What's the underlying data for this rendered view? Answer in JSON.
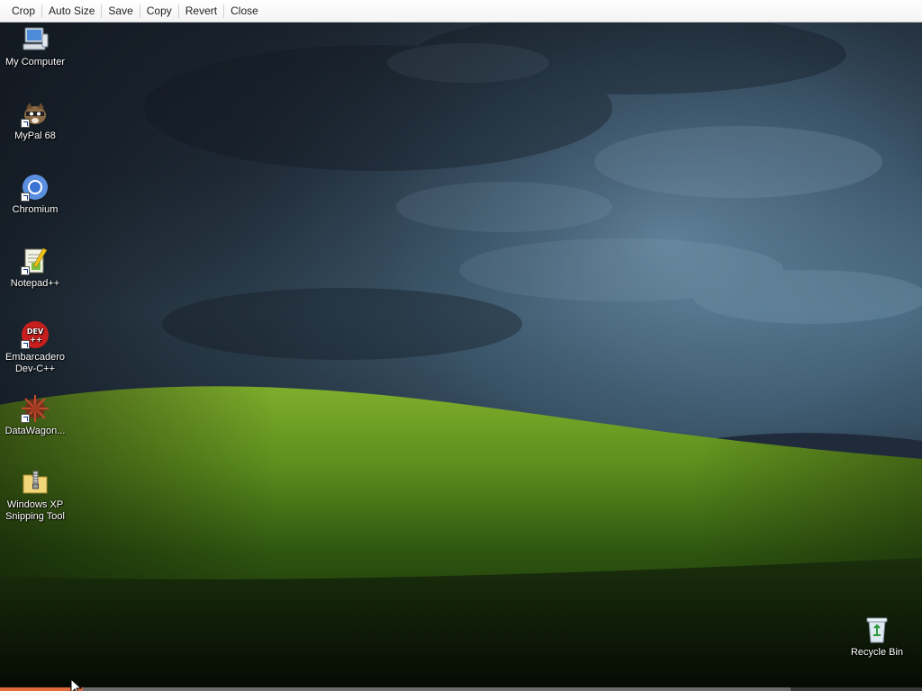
{
  "toolbar": {
    "crop": "Crop",
    "auto_size": "Auto Size",
    "save": "Save",
    "copy": "Copy",
    "revert": "Revert",
    "close": "Close"
  },
  "desktop": {
    "icons": [
      {
        "label": "My Computer",
        "icon": "computer-icon"
      },
      {
        "label": "MyPal 68",
        "icon": "mypal-icon"
      },
      {
        "label": "Chromium",
        "icon": "chromium-icon"
      },
      {
        "label": "Notepad++",
        "icon": "notepad-plus-plus-icon"
      },
      {
        "label": "Embarcadero Dev-C++",
        "icon": "devcpp-icon"
      },
      {
        "label": "DataWagon...",
        "icon": "datawagon-icon"
      },
      {
        "label": "Windows XP Snipping Tool",
        "icon": "zip-folder-icon"
      }
    ],
    "recycle_bin": {
      "label": "Recycle Bin",
      "icon": "recycle-bin-icon"
    }
  },
  "colors": {
    "sky_dark": "#1d2631",
    "sky_light": "#466479",
    "grass": "#5f8f1e",
    "toolbar_bg": "#f4f4f4",
    "bottom_accent": "#e06a3a"
  }
}
